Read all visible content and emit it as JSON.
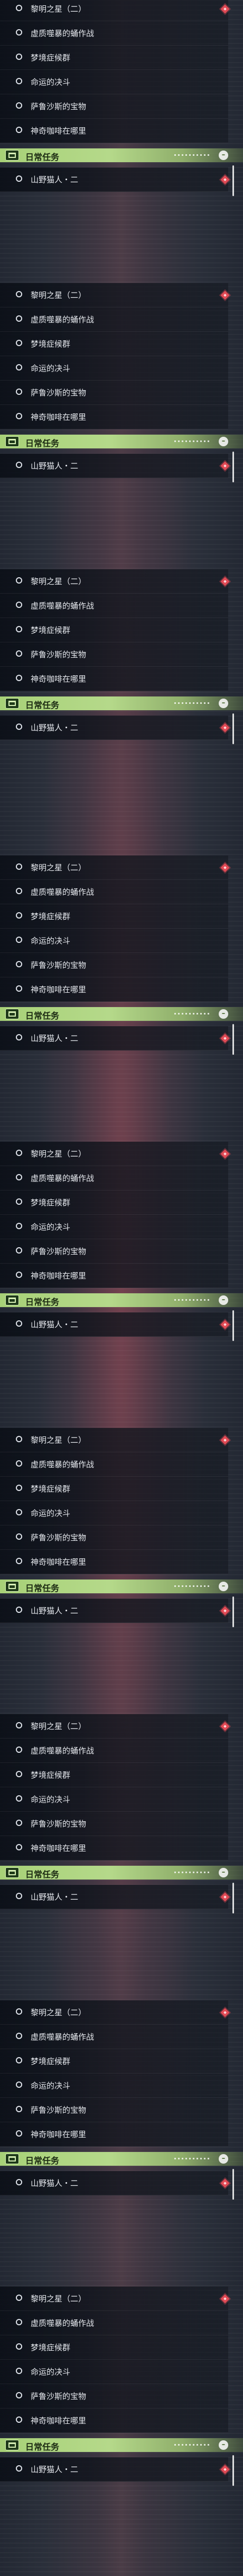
{
  "sections": [
    {
      "items": [
        {
          "label": "黎明之星（二）",
          "marker": true
        },
        {
          "label": "虚质噬暴的蛹作战",
          "marker": false
        },
        {
          "label": "梦境症候群",
          "marker": false
        },
        {
          "label": "命运的决斗",
          "marker": false
        },
        {
          "label": "萨鲁沙斯的宝物",
          "marker": false
        },
        {
          "label": "神奇咖啡在哪里",
          "marker": false
        }
      ],
      "category": {
        "label": "日常任务",
        "collapse_icon": "–"
      },
      "daily_items": [
        {
          "label": "山野猫人・二",
          "marker": true
        }
      ]
    },
    {
      "items": [
        {
          "label": "黎明之星（二）",
          "marker": true
        },
        {
          "label": "虚质噬暴的蛹作战",
          "marker": false
        },
        {
          "label": "梦境症候群",
          "marker": false
        },
        {
          "label": "命运的决斗",
          "marker": false
        },
        {
          "label": "萨鲁沙斯的宝物",
          "marker": false
        },
        {
          "label": "神奇咖啡在哪里",
          "marker": false
        }
      ],
      "category": {
        "label": "日常任务",
        "collapse_icon": "–"
      },
      "daily_items": [
        {
          "label": "山野猫人・二",
          "marker": true
        }
      ]
    },
    {
      "items": [
        {
          "label": "黎明之星（二）",
          "marker": true
        },
        {
          "label": "虚质噬暴的蛹作战",
          "marker": false
        },
        {
          "label": "梦境症候群",
          "marker": false
        },
        {
          "label": "萨鲁沙斯的宝物",
          "marker": false
        },
        {
          "label": "神奇咖啡在哪里",
          "marker": false
        }
      ],
      "category": {
        "label": "日常任务",
        "collapse_icon": "–"
      },
      "daily_items": [
        {
          "label": "山野猫人・二",
          "marker": true
        }
      ]
    },
    {
      "items": [
        {
          "label": "黎明之星（二）",
          "marker": true
        },
        {
          "label": "虚质噬暴的蛹作战",
          "marker": false
        },
        {
          "label": "梦境症候群",
          "marker": false
        },
        {
          "label": "命运的决斗",
          "marker": false
        },
        {
          "label": "萨鲁沙斯的宝物",
          "marker": false
        },
        {
          "label": "神奇咖啡在哪里",
          "marker": false
        }
      ],
      "category": {
        "label": "日常任务",
        "collapse_icon": "–"
      },
      "daily_items": [
        {
          "label": "山野猫人・二",
          "marker": true
        }
      ]
    },
    {
      "items": [
        {
          "label": "黎明之星（二）",
          "marker": true
        },
        {
          "label": "虚质噬暴的蛹作战",
          "marker": false
        },
        {
          "label": "梦境症候群",
          "marker": false
        },
        {
          "label": "命运的决斗",
          "marker": false
        },
        {
          "label": "萨鲁沙斯的宝物",
          "marker": false
        },
        {
          "label": "神奇咖啡在哪里",
          "marker": false
        }
      ],
      "category": {
        "label": "日常任务",
        "collapse_icon": "–"
      },
      "daily_items": [
        {
          "label": "山野猫人・二",
          "marker": true
        }
      ]
    },
    {
      "items": [
        {
          "label": "黎明之星（二）",
          "marker": true
        },
        {
          "label": "虚质噬暴的蛹作战",
          "marker": false
        },
        {
          "label": "梦境症候群",
          "marker": false
        },
        {
          "label": "命运的决斗",
          "marker": false
        },
        {
          "label": "萨鲁沙斯的宝物",
          "marker": false
        },
        {
          "label": "神奇咖啡在哪里",
          "marker": false
        }
      ],
      "category": {
        "label": "日常任务",
        "collapse_icon": "–"
      },
      "daily_items": [
        {
          "label": "山野猫人・二",
          "marker": true
        }
      ]
    },
    {
      "items": [
        {
          "label": "黎明之星（二）",
          "marker": true
        },
        {
          "label": "虚质噬暴的蛹作战",
          "marker": false
        },
        {
          "label": "梦境症候群",
          "marker": false
        },
        {
          "label": "命运的决斗",
          "marker": false
        },
        {
          "label": "萨鲁沙斯的宝物",
          "marker": false
        },
        {
          "label": "神奇咖啡在哪里",
          "marker": false
        }
      ],
      "category": {
        "label": "日常任务",
        "collapse_icon": "–"
      },
      "daily_items": [
        {
          "label": "山野猫人・二",
          "marker": true
        }
      ]
    },
    {
      "items": [
        {
          "label": "黎明之星（二）",
          "marker": true
        },
        {
          "label": "虚质噬暴的蛹作战",
          "marker": false
        },
        {
          "label": "梦境症候群",
          "marker": false
        },
        {
          "label": "命运的决斗",
          "marker": false
        },
        {
          "label": "萨鲁沙斯的宝物",
          "marker": false
        },
        {
          "label": "神奇咖啡在哪里",
          "marker": false
        }
      ],
      "category": {
        "label": "日常任务",
        "collapse_icon": "–"
      },
      "daily_items": [
        {
          "label": "山野猫人・二",
          "marker": true
        }
      ]
    },
    {
      "items": [
        {
          "label": "黎明之星（二）",
          "marker": true
        },
        {
          "label": "虚质噬暴的蛹作战",
          "marker": false
        },
        {
          "label": "梦境症候群",
          "marker": false
        },
        {
          "label": "命运的决斗",
          "marker": false
        },
        {
          "label": "萨鲁沙斯的宝物",
          "marker": false
        },
        {
          "label": "神奇咖啡在哪里",
          "marker": false
        }
      ],
      "category": {
        "label": "日常任务",
        "collapse_icon": "–"
      },
      "daily_items": [
        {
          "label": "山野猫人・二",
          "marker": true
        }
      ]
    }
  ]
}
